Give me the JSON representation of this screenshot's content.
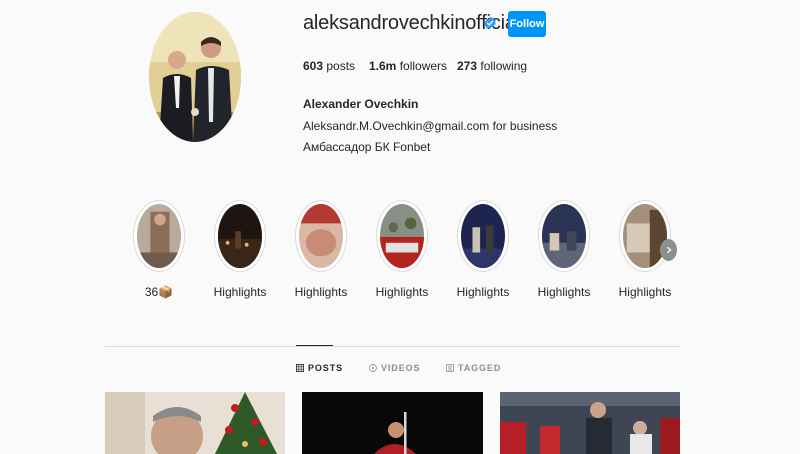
{
  "profile": {
    "username": "aleksandrovechkinofficial",
    "follow_label": "Follow",
    "stats": [
      {
        "value": "603",
        "label": "posts"
      },
      {
        "value": "1.6m",
        "label": "followers"
      },
      {
        "value": "273",
        "label": "following"
      }
    ],
    "full_name": "Alexander Ovechkin",
    "bio": [
      "Aleksandr.M.Ovechkin@gmail.com for business",
      "Амбассадор БК Fonbet"
    ]
  },
  "highlights": [
    {
      "label": "36📦"
    },
    {
      "label": "Highlights"
    },
    {
      "label": "Highlights"
    },
    {
      "label": "Highlights"
    },
    {
      "label": "Highlights"
    },
    {
      "label": "Highlights"
    },
    {
      "label": "Highlights"
    }
  ],
  "tabs": [
    {
      "label": "POSTS",
      "icon": "grid-icon",
      "active": true
    },
    {
      "label": "VIDEOS",
      "icon": "play-circle-icon",
      "active": false
    },
    {
      "label": "TAGGED",
      "icon": "tag-person-icon",
      "active": false
    }
  ],
  "colors": {
    "accent": "#0095f6",
    "text": "#262626",
    "muted": "#8e8e8e",
    "border": "#dbdbdb",
    "background": "#fafafa"
  }
}
